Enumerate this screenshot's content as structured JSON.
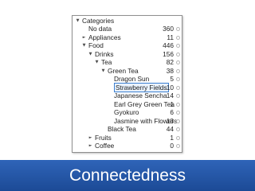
{
  "tree": {
    "items": [
      {
        "label": "Categories",
        "count": "",
        "level": 0,
        "arrow": "▼",
        "selected": false
      },
      {
        "label": "No data",
        "count": "360",
        "level": 1,
        "arrow": "",
        "selected": false
      },
      {
        "label": "Appliances",
        "count": "11",
        "level": 1,
        "arrow": "►",
        "selected": false
      },
      {
        "label": "Food",
        "count": "446",
        "level": 1,
        "arrow": "▼",
        "selected": false
      },
      {
        "label": "Drinks",
        "count": "156",
        "level": 2,
        "arrow": "▼",
        "selected": false
      },
      {
        "label": "Tea",
        "count": "82",
        "level": 3,
        "arrow": "▼",
        "selected": false
      },
      {
        "label": "Green Tea",
        "count": "38",
        "level": 4,
        "arrow": "▼",
        "selected": false
      },
      {
        "label": "Dragon Sun",
        "count": "5",
        "level": 5,
        "arrow": "",
        "selected": false
      },
      {
        "label": "Strawberry Fields",
        "count": "10",
        "level": 5,
        "arrow": "",
        "selected": true
      },
      {
        "label": "Japanese Sencha",
        "count": "14",
        "level": 5,
        "arrow": "",
        "selected": false
      },
      {
        "label": "Earl Grey Green Tea",
        "count": "1",
        "level": 5,
        "arrow": "",
        "selected": false
      },
      {
        "label": "Gyokuro",
        "count": "6",
        "level": 5,
        "arrow": "",
        "selected": false
      },
      {
        "label": "Jasmine with Flowers",
        "count": "13",
        "level": 5,
        "arrow": "",
        "selected": false
      },
      {
        "label": "Black Tea",
        "count": "44",
        "level": 4,
        "arrow": "",
        "selected": false
      },
      {
        "label": "Fruits",
        "count": "1",
        "level": 2,
        "arrow": "►",
        "selected": false
      },
      {
        "label": "Coffee",
        "count": "0",
        "level": 2,
        "arrow": "►",
        "selected": false
      }
    ]
  },
  "footer": {
    "title": "Connectedness"
  }
}
